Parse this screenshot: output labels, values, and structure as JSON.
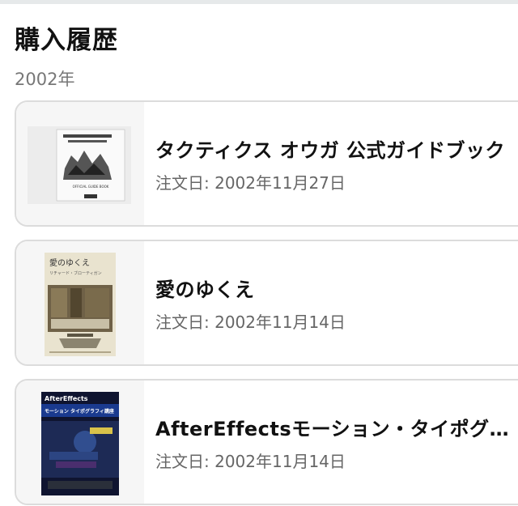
{
  "page": {
    "title": "購入履歴",
    "year": "2002年"
  },
  "orders": [
    {
      "title": "タクティクス オウガ 公式ガイドブック",
      "date": "注文日: 2002年11月27日",
      "cover_text": "OFFICIAL GUIDE BOOK"
    },
    {
      "title": "愛のゆくえ",
      "date": "注文日: 2002年11月14日",
      "cover_title": "愛のゆくえ",
      "cover_author": "リチャード・ブローティガン"
    },
    {
      "title": "AfterEffectsモーション・タイポグラフィ講座",
      "date": "注文日: 2002年11月14日",
      "cover_title": "AfterEffects",
      "cover_subtitle": "モーション タイポグラフィ講座"
    }
  ]
}
